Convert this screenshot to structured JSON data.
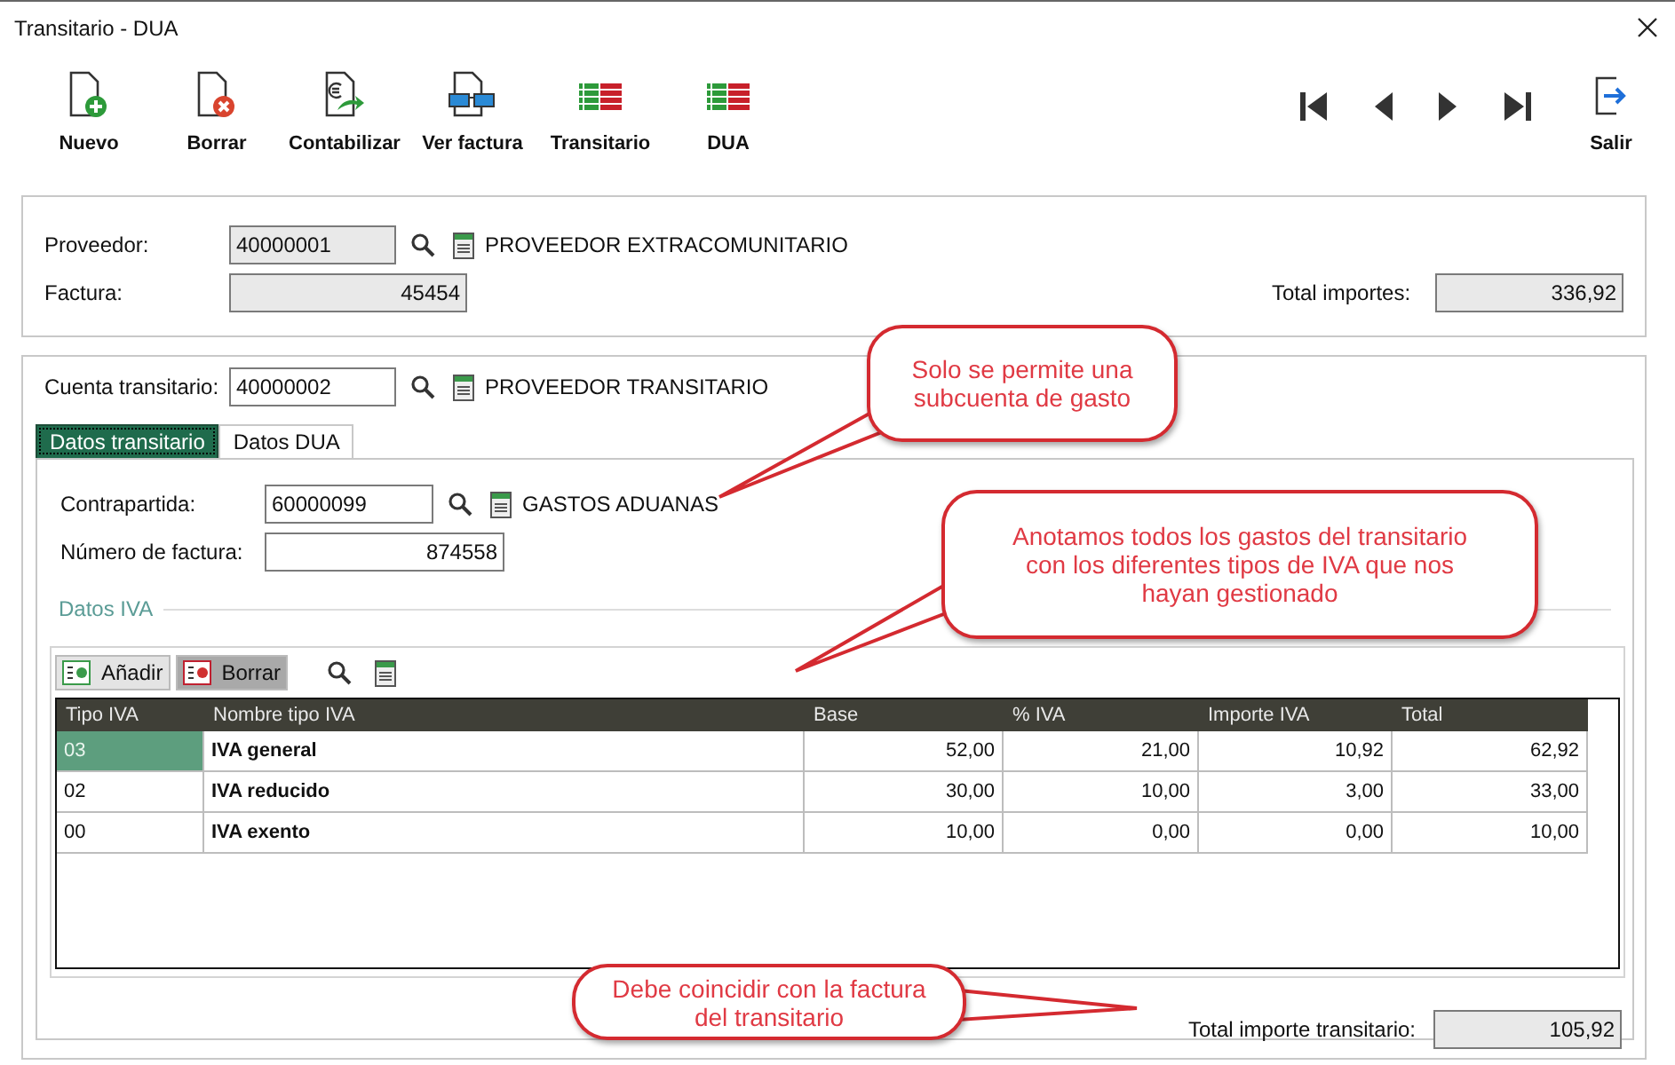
{
  "window": {
    "title": "Transitario - DUA"
  },
  "toolbar": [
    {
      "label": "Nuevo",
      "kind": "new"
    },
    {
      "label": "Borrar",
      "kind": "delete"
    },
    {
      "label": "Contabilizar",
      "kind": "post"
    },
    {
      "label": "Ver factura",
      "kind": "view"
    },
    {
      "label": "Transitario",
      "kind": "grid"
    },
    {
      "label": "DUA",
      "kind": "grid"
    }
  ],
  "exit_button": {
    "label": "Salir"
  },
  "supplier_panel": {
    "fields": [
      {
        "label": "Proveedor:",
        "value": "40000001",
        "readonly": true,
        "description": "PROVEEDOR EXTRACOMUNITARIO"
      },
      {
        "label": "Factura:",
        "value": "45454",
        "kind": "number",
        "readonly": true
      }
    ],
    "total": {
      "label": "Total importes:",
      "value": "336,92"
    }
  },
  "forwarder_account": {
    "label": "Cuenta transitario:",
    "value": "40000002",
    "readonly": false,
    "description": "PROVEEDOR TRANSITARIO"
  },
  "tabs": [
    {
      "label": "Datos transitario",
      "selected": true
    },
    {
      "label": "Datos DUA",
      "selected": false
    }
  ],
  "transit_fields": [
    {
      "label": "Contrapartida:",
      "value": "60000099",
      "readonly": false,
      "description": "GASTOS ADUANAS"
    },
    {
      "label": "Número de factura:",
      "value": "874558",
      "kind": "number",
      "readonly": false
    }
  ],
  "vat_group": {
    "title": "Datos IVA",
    "buttons": [
      {
        "label": "Añadir",
        "kind": "add"
      },
      {
        "label": "Borrar",
        "kind": "delete"
      }
    ],
    "table": {
      "columns": [
        "Tipo IVA",
        "Nombre tipo IVA",
        "Base",
        "% IVA",
        "Importe IVA",
        "Total"
      ],
      "rows": [
        {
          "selected": true,
          "cells": [
            "03",
            "IVA general",
            "52,00",
            "21,00",
            "10,92",
            "62,92"
          ]
        },
        {
          "selected": false,
          "cells": [
            "02",
            "IVA reducido",
            "30,00",
            "10,00",
            "3,00",
            "33,00"
          ]
        },
        {
          "selected": false,
          "cells": [
            "00",
            "IVA exento",
            "10,00",
            "0,00",
            "0,00",
            "10,00"
          ]
        }
      ]
    }
  },
  "transit_total": {
    "label": "Total importe transitario:",
    "value": "105,92"
  },
  "callouts": [
    {
      "text": "Solo se permite una subcuenta de gasto"
    },
    {
      "text": "Anotamos todos los gastos del transitario con los diferentes tipos de IVA que nos hayan gestionado"
    },
    {
      "text": "Debe coincidir con la factura del transitario"
    }
  ]
}
